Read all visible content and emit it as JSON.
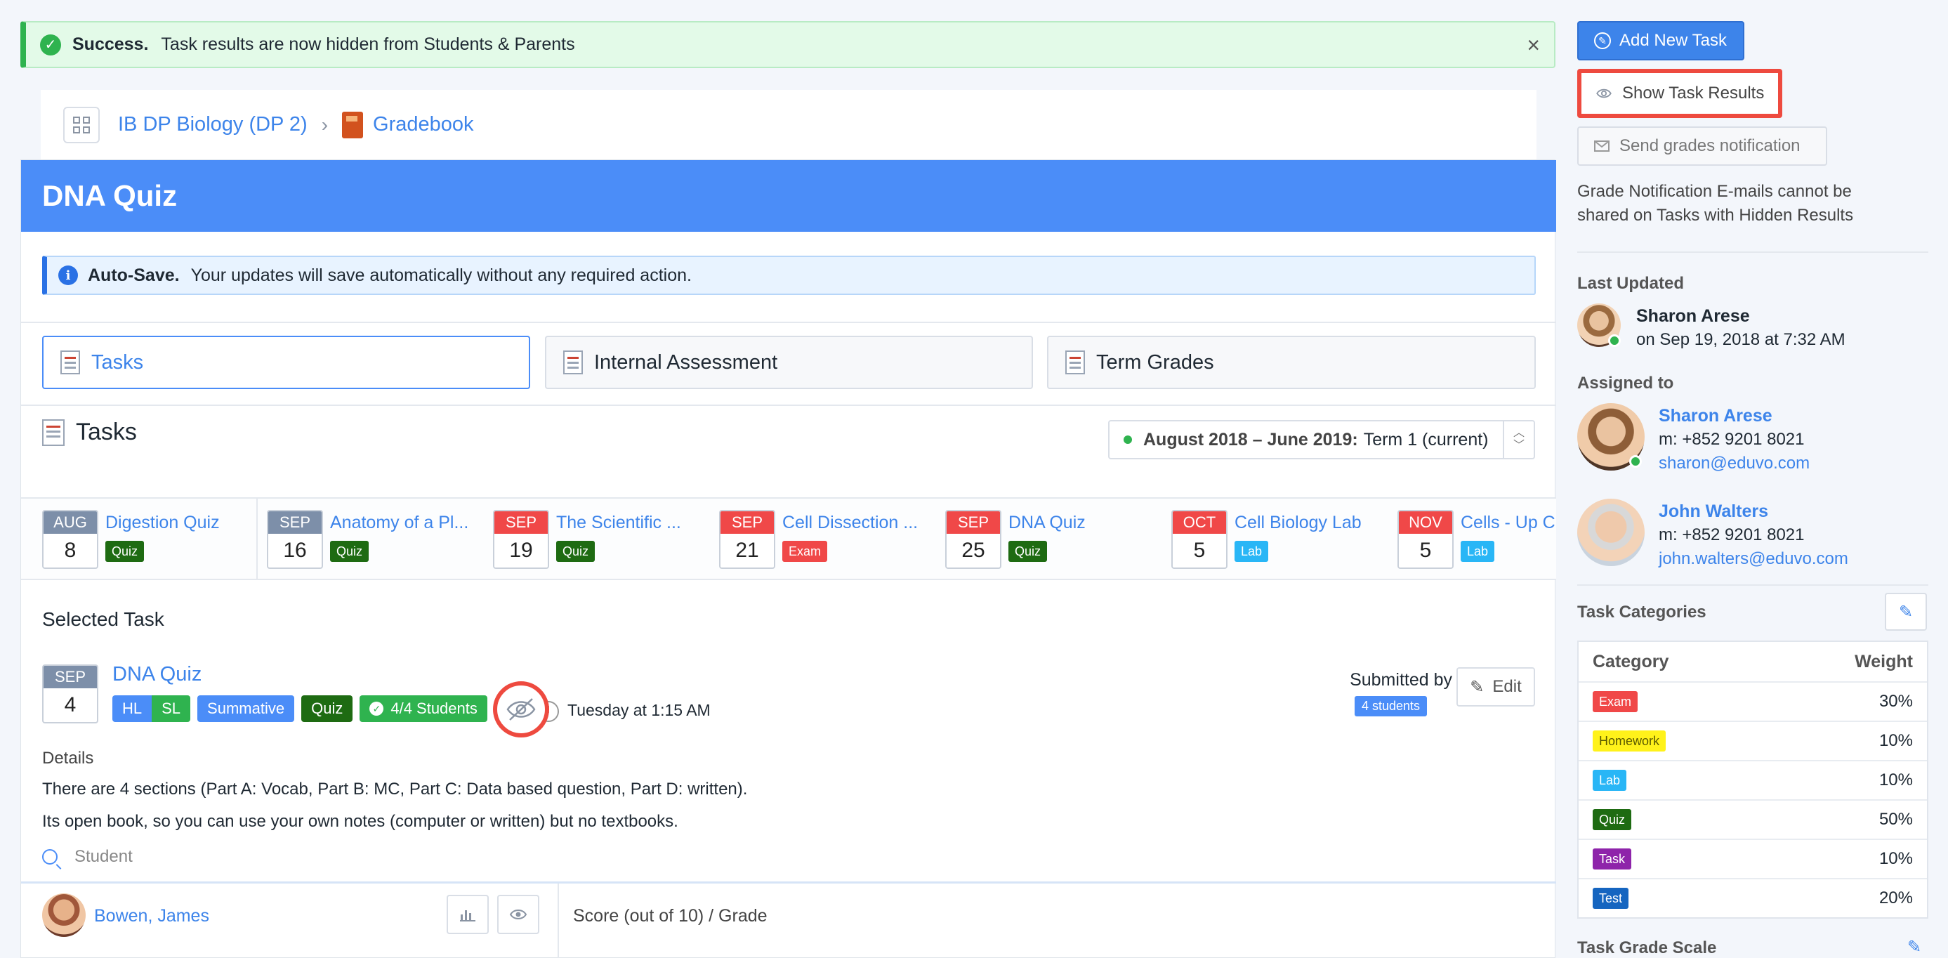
{
  "alert": {
    "title": "Success.",
    "message": "Task results are now hidden from Students & Parents"
  },
  "breadcrumb": {
    "course": "IB DP Biology (DP 2)",
    "page": "Gradebook"
  },
  "panel_title": "DNA Quiz",
  "autosave": {
    "title": "Auto-Save.",
    "message": "Your updates will save automatically without any required action."
  },
  "tabs": [
    {
      "label": "Tasks",
      "active": true
    },
    {
      "label": "Internal Assessment",
      "active": false
    },
    {
      "label": "Term Grades",
      "active": false
    }
  ],
  "tasks_header": "Tasks",
  "term": {
    "range": "August 2018 – June 2019:",
    "name": "Term 1 (current)"
  },
  "timeline": [
    {
      "month": "AUG",
      "day": "8",
      "name": "Digestion Quiz",
      "type": "Quiz",
      "month_color": "#7d8fa9"
    },
    {
      "month": "SEP",
      "day": "16",
      "name": "Anatomy of a Pl...",
      "type": "Quiz",
      "month_color": "#7d8fa9"
    },
    {
      "month": "SEP",
      "day": "19",
      "name": "The Scientific ...",
      "type": "Quiz",
      "month_color": "#f04848"
    },
    {
      "month": "SEP",
      "day": "21",
      "name": "Cell Dissection ...",
      "type": "Exam",
      "month_color": "#f04848"
    },
    {
      "month": "SEP",
      "day": "25",
      "name": "DNA Quiz",
      "type": "Quiz",
      "month_color": "#f04848"
    },
    {
      "month": "OCT",
      "day": "5",
      "name": "Cell Biology Lab",
      "type": "Lab",
      "month_color": "#f04848"
    },
    {
      "month": "NOV",
      "day": "5",
      "name": "Cells - Up C",
      "type": "Lab",
      "month_color": "#f04848"
    }
  ],
  "selected": {
    "heading": "Selected Task",
    "month": "SEP",
    "day": "4",
    "name": "DNA Quiz",
    "badges": {
      "hl": "HL",
      "sl": "SL",
      "kind": "Summative",
      "type": "Quiz",
      "students": "4/4 Students"
    },
    "time": "Tuesday at 1:15 AM",
    "submitted_by": "Submitted by",
    "submitted_count": "4 students",
    "edit": "Edit",
    "details_label": "Details",
    "details": [
      "There are 4 sections (Part A: Vocab, Part B: MC, Part C: Data based question, Part D: written).",
      "Its open book, so you can use your own notes (computer or written) but no textbooks."
    ],
    "search_placeholder": "Student"
  },
  "student": {
    "name": "Bowen, James",
    "score_label": "Score (out of 10) / Grade"
  },
  "sidebar": {
    "add_task": "Add New Task",
    "show_results": "Show Task Results",
    "send_grades": "Send grades notification",
    "grade_note": "Grade Notification E-mails cannot be shared on Tasks with Hidden Results",
    "last_updated_label": "Last Updated",
    "last_updated_name": "Sharon Arese",
    "last_updated_time": "on Sep 19, 2018 at 7:32 AM",
    "assigned_label": "Assigned to",
    "assigned": [
      {
        "name": "Sharon Arese",
        "phone": "m: +852 9201 8021",
        "email": "sharon@eduvo.com"
      },
      {
        "name": "John Walters",
        "phone": "m: +852 9201 8021",
        "email": "john.walters@eduvo.com"
      }
    ],
    "categories_label": "Task Categories",
    "categories_header": {
      "category": "Category",
      "weight": "Weight"
    },
    "categories": [
      {
        "name": "Exam",
        "weight": "30%",
        "color": "#f04848",
        "text": "#ffffff"
      },
      {
        "name": "Homework",
        "weight": "10%",
        "color": "#fff21a",
        "text": "#5a5a00"
      },
      {
        "name": "Lab",
        "weight": "10%",
        "color": "#29b6f6",
        "text": "#ffffff"
      },
      {
        "name": "Quiz",
        "weight": "50%",
        "color": "#1e6b12",
        "text": "#ffffff"
      },
      {
        "name": "Task",
        "weight": "10%",
        "color": "#8e24aa",
        "text": "#ffffff"
      },
      {
        "name": "Test",
        "weight": "20%",
        "color": "#1565c0",
        "text": "#ffffff"
      }
    ],
    "grade_scale_label": "Task Grade Scale"
  },
  "colors": {
    "primary": "#4b8df8",
    "success": "#2fb34f",
    "danger": "#ee4a3f",
    "quiz": "#1e6b12",
    "exam": "#f04848",
    "lab": "#29b6f6"
  }
}
